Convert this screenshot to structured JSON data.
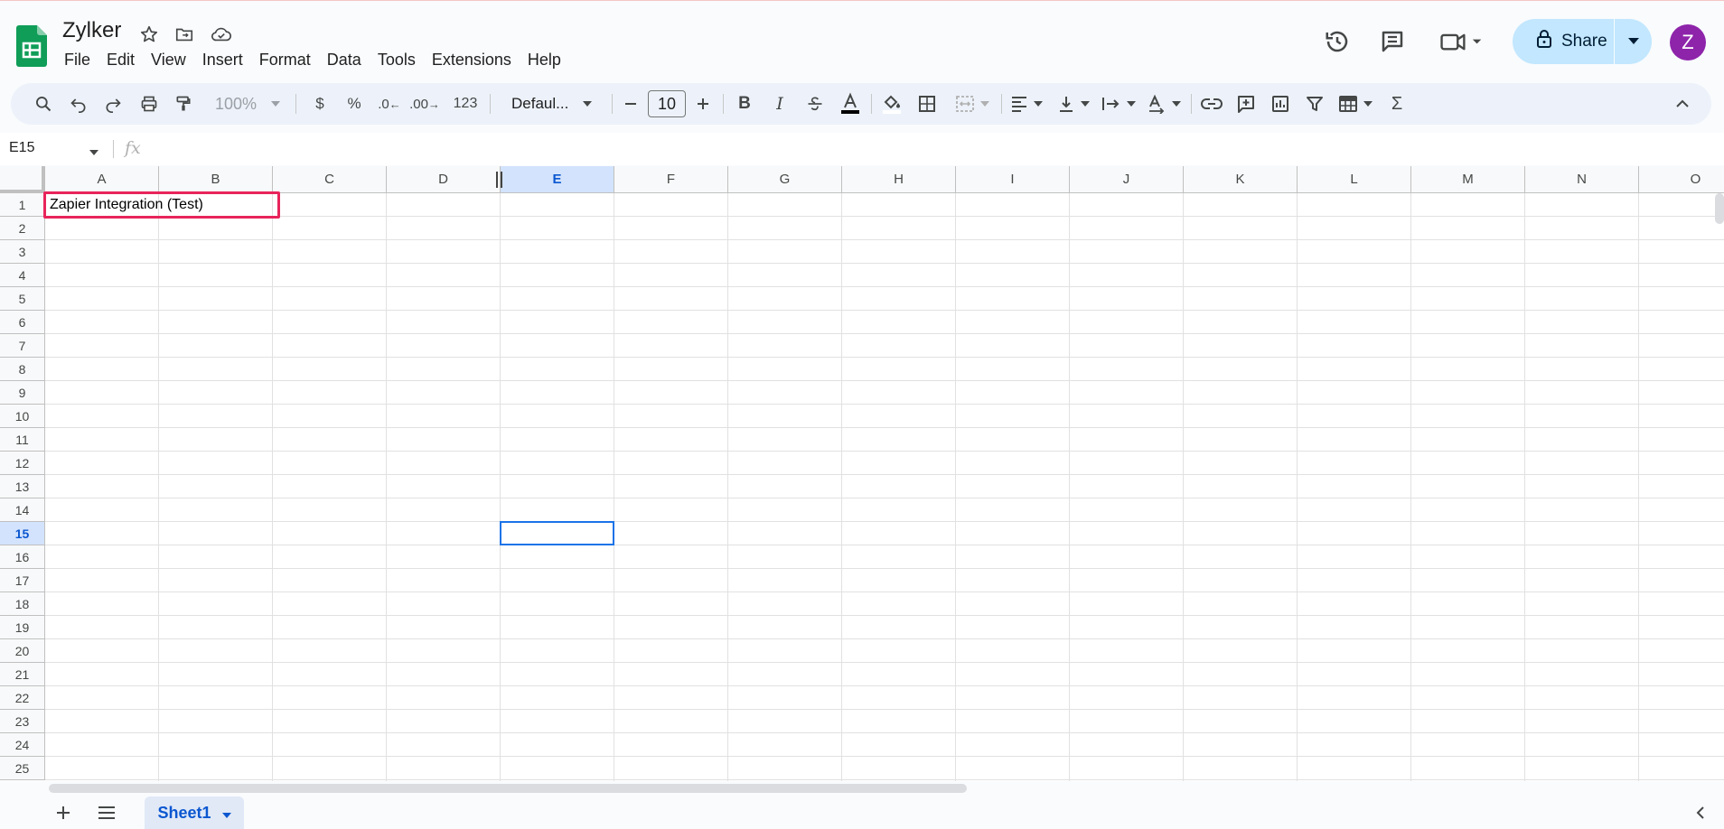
{
  "app": {
    "doc_title": "Zylker",
    "menu": [
      "File",
      "Edit",
      "View",
      "Insert",
      "Format",
      "Data",
      "Tools",
      "Extensions",
      "Help"
    ],
    "share_label": "Share",
    "avatar_initial": "Z",
    "colors": {
      "brand_green": "#0f9d58",
      "share_bg": "#c2e7ff",
      "avatar_bg": "#8e24aa",
      "highlight_red": "#e8245b",
      "active_blue": "#1a73e8"
    }
  },
  "toolbar": {
    "zoom": "100%",
    "currency": "$",
    "percent": "%",
    "decrease_decimal": ".0",
    "increase_decimal": ".00",
    "number_format": "123",
    "font": "Defaul...",
    "font_size": "10",
    "icons": [
      "search-icon",
      "undo-icon",
      "redo-icon",
      "print-icon",
      "paint-format-icon",
      "minus-icon",
      "plus-icon",
      "bold-icon",
      "italic-icon",
      "strikethrough-icon",
      "text-color-icon",
      "fill-color-icon",
      "borders-icon",
      "merge-cells-icon",
      "align-left-icon",
      "valign-bottom-icon",
      "text-wrap-icon",
      "text-rotate-icon",
      "link-icon",
      "comment-icon",
      "chart-icon",
      "filter-icon",
      "table-icon",
      "sum-icon",
      "collapse-icon"
    ]
  },
  "formula_bar": {
    "name_box": "E15",
    "fx": "fx"
  },
  "grid": {
    "columns": [
      "A",
      "B",
      "C",
      "D",
      "E",
      "F",
      "G",
      "H",
      "I",
      "J",
      "K",
      "L",
      "M",
      "N",
      "O"
    ],
    "rows": [
      "1",
      "2",
      "3",
      "4",
      "5",
      "6",
      "7",
      "8",
      "9",
      "10",
      "11",
      "12",
      "13",
      "14",
      "15",
      "16",
      "17",
      "18",
      "19",
      "20",
      "21",
      "22",
      "23",
      "24",
      "25"
    ],
    "selected_column": "E",
    "selected_row": "15",
    "cells": {
      "A1": "Zapier Integration (Test)"
    }
  },
  "sheets": {
    "tabs": [
      "Sheet1"
    ]
  }
}
